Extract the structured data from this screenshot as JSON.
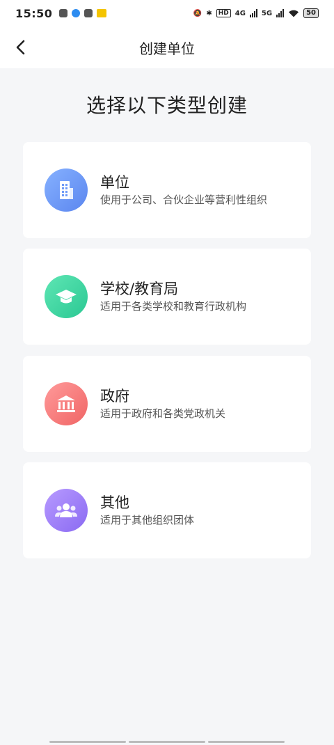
{
  "status": {
    "time": "15:50",
    "network_4g": "4G",
    "network_5g": "5G",
    "hd": "HD",
    "battery": "50"
  },
  "header": {
    "title": "创建单位"
  },
  "prompt": "选择以下类型创建",
  "options": [
    {
      "title": "单位",
      "desc": "使用于公司、合伙企业等营利性组织",
      "icon": "building-icon",
      "color": "#6f9bf7"
    },
    {
      "title": "学校/教育局",
      "desc": "适用于各类学校和教育行政机构",
      "icon": "graduation-cap-icon",
      "color": "#3ed6a2"
    },
    {
      "title": "政府",
      "desc": "适用于政府和各类党政机关",
      "icon": "government-building-icon",
      "color": "#f77c7c"
    },
    {
      "title": "其他",
      "desc": "适用于其他组织团体",
      "icon": "group-icon",
      "color": "#9f80f8"
    }
  ]
}
